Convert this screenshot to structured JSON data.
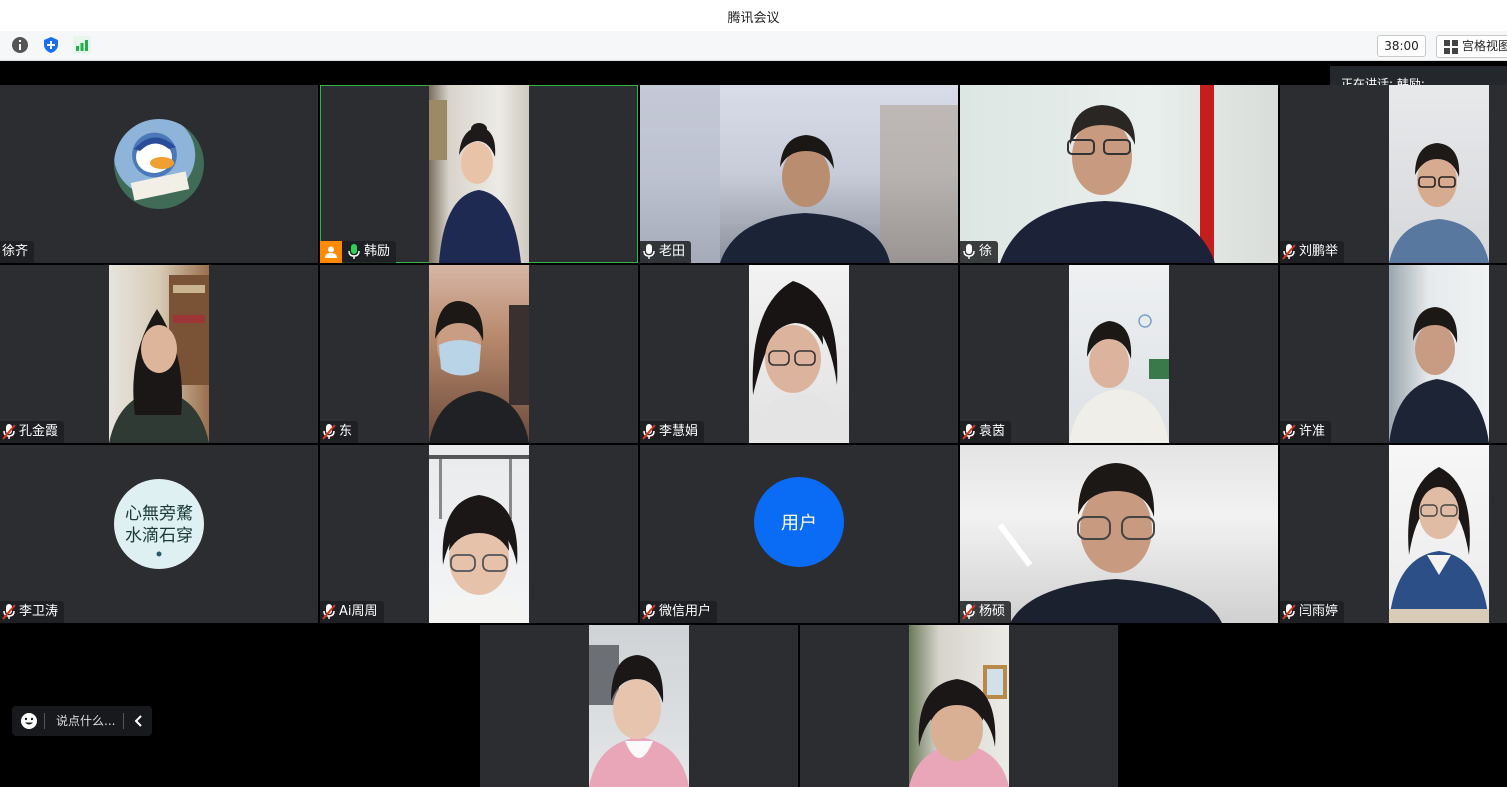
{
  "window": {
    "title": "腾讯会议"
  },
  "toolbar": {
    "timer": "38:00",
    "grid_view_label": "宫格视图"
  },
  "speaking_indicator": "正在讲话: 韩励;",
  "chat": {
    "placeholder": "说点什么..."
  },
  "participants": [
    {
      "name": "徐齐",
      "mic": "none"
    },
    {
      "name": "韩励",
      "mic": "on"
    },
    {
      "name": "老田",
      "mic": "on"
    },
    {
      "name": "徐",
      "mic": "on"
    },
    {
      "name": "刘鹏举",
      "mic": "muted"
    },
    {
      "name": "孔金霞",
      "mic": "muted"
    },
    {
      "name": "东",
      "mic": "muted"
    },
    {
      "name": "李慧娟",
      "mic": "muted"
    },
    {
      "name": "袁茵",
      "mic": "muted"
    },
    {
      "name": "许准",
      "mic": "muted"
    },
    {
      "name": "李卫涛",
      "mic": "muted"
    },
    {
      "name": "Ai周周",
      "mic": "muted"
    },
    {
      "name": "微信用户",
      "mic": "muted"
    },
    {
      "name": "杨硕",
      "mic": "muted"
    },
    {
      "name": "闫雨婷",
      "mic": "muted"
    }
  ],
  "avatar_texts": {
    "calligraphy": "心無旁騖 水滴石穿",
    "user_placeholder": "用户"
  },
  "colors": {
    "active_border": "#2fb44a",
    "host_badge": "#ff8a00",
    "user_avatar": "#0a6cf5",
    "muted_mic": "#e0301e"
  }
}
